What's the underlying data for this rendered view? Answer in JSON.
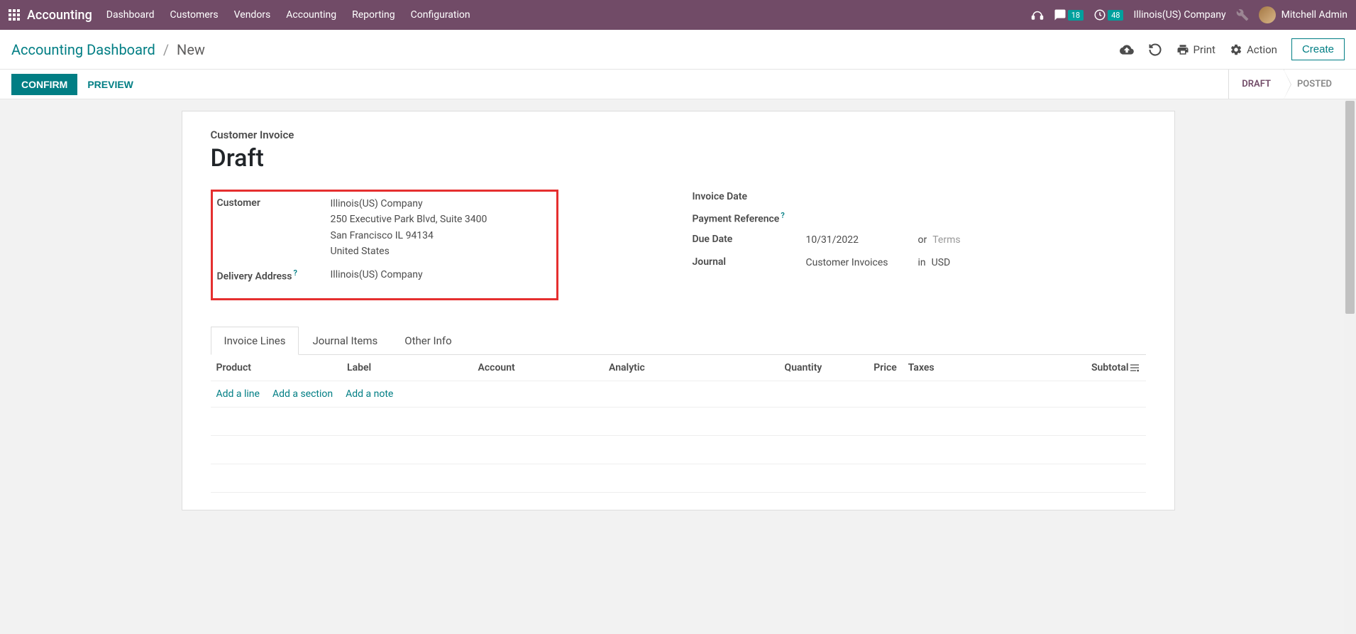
{
  "topbar": {
    "app_name": "Accounting",
    "menu": [
      "Dashboard",
      "Customers",
      "Vendors",
      "Accounting",
      "Reporting",
      "Configuration"
    ],
    "messages_badge": "18",
    "activities_badge": "48",
    "company": "Illinois(US) Company",
    "user": "Mitchell Admin"
  },
  "controlbar": {
    "breadcrumb_root": "Accounting Dashboard",
    "breadcrumb_current": "New",
    "print": "Print",
    "action": "Action",
    "create": "Create"
  },
  "statusbar": {
    "confirm": "CONFIRM",
    "preview": "PREVIEW",
    "status_draft": "DRAFT",
    "status_posted": "POSTED"
  },
  "form": {
    "doc_type": "Customer Invoice",
    "doc_title": "Draft",
    "left": {
      "customer_label": "Customer",
      "customer_name": "Illinois(US) Company",
      "customer_addr1": "250 Executive Park Blvd, Suite 3400",
      "customer_addr2": "San Francisco IL 94134",
      "customer_addr3": "United States",
      "delivery_label": "Delivery Address",
      "delivery_value": "Illinois(US) Company"
    },
    "right": {
      "invoice_date_label": "Invoice Date",
      "payment_ref_label": "Payment Reference",
      "due_date_label": "Due Date",
      "due_date_value": "10/31/2022",
      "or_label": "or",
      "terms_placeholder": "Terms",
      "journal_label": "Journal",
      "journal_value": "Customer Invoices",
      "in_label": "in",
      "currency_value": "USD"
    },
    "tabs": [
      "Invoice Lines",
      "Journal Items",
      "Other Info"
    ],
    "columns": {
      "product": "Product",
      "label": "Label",
      "account": "Account",
      "analytic": "Analytic",
      "quantity": "Quantity",
      "price": "Price",
      "taxes": "Taxes",
      "subtotal": "Subtotal"
    },
    "add_links": {
      "line": "Add a line",
      "section": "Add a section",
      "note": "Add a note"
    }
  }
}
